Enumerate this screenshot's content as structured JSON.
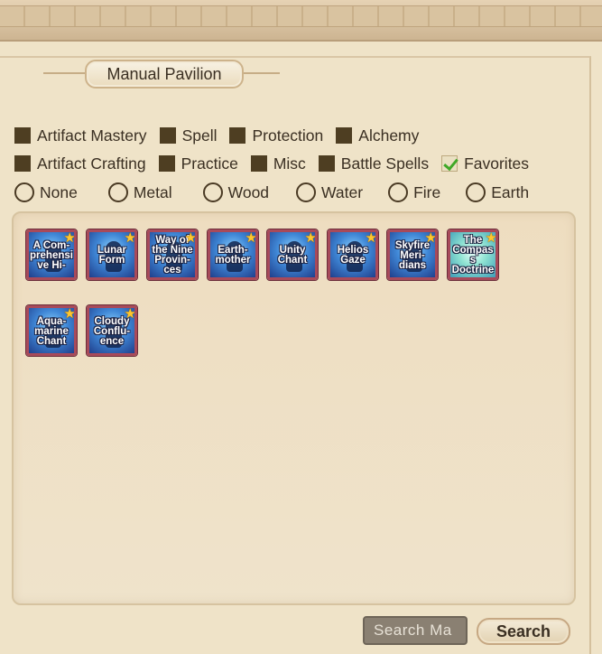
{
  "title": "Manual Pavilion",
  "category_filters_row1": [
    {
      "label": "Artifact Mastery",
      "checked": false
    },
    {
      "label": "Spell",
      "checked": false
    },
    {
      "label": "Protection",
      "checked": false
    },
    {
      "label": "Alchemy",
      "checked": false
    }
  ],
  "category_filters_row2": [
    {
      "label": "Artifact Crafting",
      "checked": false
    },
    {
      "label": "Practice",
      "checked": false
    },
    {
      "label": "Misc",
      "checked": false
    },
    {
      "label": "Battle Spells",
      "checked": false
    },
    {
      "label": "Favorites",
      "checked": true
    }
  ],
  "element_filters": [
    {
      "label": "None",
      "selected": false
    },
    {
      "label": "Metal",
      "selected": false
    },
    {
      "label": "Wood",
      "selected": false
    },
    {
      "label": "Water",
      "selected": false
    },
    {
      "label": "Fire",
      "selected": false
    },
    {
      "label": "Earth",
      "selected": false
    }
  ],
  "manuals": [
    {
      "label": "A Com-prehensive Hi-",
      "favorite": true,
      "icon": "blue-figure-icon"
    },
    {
      "label": "Lunar Form",
      "favorite": true,
      "icon": "blue-figure-icon"
    },
    {
      "label": "Way of the Nine Provin-ces",
      "favorite": true,
      "icon": "blue-figure-icon"
    },
    {
      "label": "Earth-mother",
      "favorite": true,
      "icon": "blue-figure-icon"
    },
    {
      "label": "Unity Chant",
      "favorite": true,
      "icon": "blue-figure-icon"
    },
    {
      "label": "Helios Gaze",
      "favorite": true,
      "icon": "blue-figure-icon"
    },
    {
      "label": "Skyfire Meri-dians",
      "favorite": true,
      "icon": "blue-figure-icon"
    },
    {
      "label": "The Compass Doctrine",
      "favorite": true,
      "icon": "teal-glow-icon"
    },
    {
      "label": "Aqua-marine Chant",
      "favorite": true,
      "icon": "blue-figure-icon"
    },
    {
      "label": "Cloudy Conflu-ence",
      "favorite": true,
      "icon": "blue-figure-icon"
    }
  ],
  "search": {
    "value": "Search Ma",
    "button_label": "Search"
  },
  "colors": {
    "checkbox_fill": "#4e3e22",
    "checkmark": "#3fa827",
    "star": "#ffc62e",
    "panel_bg": "#efe3c8"
  }
}
